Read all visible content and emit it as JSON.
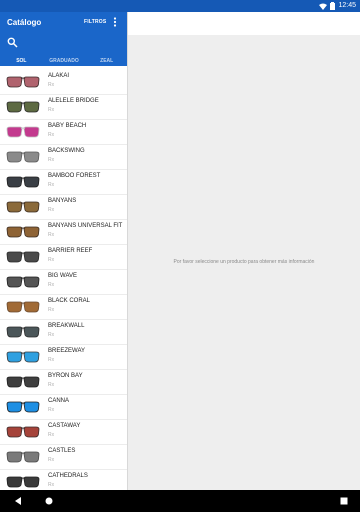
{
  "status_bar": {
    "time": "12:45"
  },
  "header": {
    "title": "Catálogo",
    "filters_label": "FILTROS"
  },
  "tabs": [
    {
      "label": "SOL",
      "active": true
    },
    {
      "label": "GRADUADO",
      "active": false
    },
    {
      "label": "ZEAL",
      "active": false
    }
  ],
  "products": [
    {
      "name": "ALAKAI",
      "sub": "Rx",
      "color": "#b0636e",
      "frame": "#3a2a2a"
    },
    {
      "name": "ALELELE BRIDGE",
      "sub": "Rx",
      "color": "#5d6a42",
      "frame": "#2a2a2a"
    },
    {
      "name": "BABY BEACH",
      "sub": "Rx",
      "color": "#c33a8e",
      "frame": "#c0c0c0"
    },
    {
      "name": "BACKSWING",
      "sub": "Rx",
      "color": "#8a8a8a",
      "frame": "#5a5a5a"
    },
    {
      "name": "BAMBOO FOREST",
      "sub": "Rx",
      "color": "#3a3f45",
      "frame": "#1f1f1f"
    },
    {
      "name": "BANYANS",
      "sub": "Rx",
      "color": "#8b6a3a",
      "frame": "#3a2b20"
    },
    {
      "name": "BANYANS UNIVERSAL FIT",
      "sub": "Rx",
      "color": "#8e6335",
      "frame": "#3a2b20"
    },
    {
      "name": "BARRIER REEF",
      "sub": "Rx",
      "color": "#4a4a4a",
      "frame": "#2a2a2a"
    },
    {
      "name": "BIG WAVE",
      "sub": "Rx",
      "color": "#555555",
      "frame": "#1f1f1f"
    },
    {
      "name": "BLACK CORAL",
      "sub": "Rx",
      "color": "#a16a35",
      "frame": "#6a4a30"
    },
    {
      "name": "BREAKWALL",
      "sub": "Rx",
      "color": "#4b5659",
      "frame": "#2b2b2b"
    },
    {
      "name": "BREEZEWAY",
      "sub": "Rx",
      "color": "#2fa0e0",
      "frame": "#3a3a3a"
    },
    {
      "name": "BYRON BAY",
      "sub": "Rx",
      "color": "#3f3f3f",
      "frame": "#1f1f1f"
    },
    {
      "name": "CANNA",
      "sub": "Rx",
      "color": "#1e8fe3",
      "frame": "#1f1f1f"
    },
    {
      "name": "CASTAWAY",
      "sub": "Rx",
      "color": "#a5433a",
      "frame": "#3a2b2b"
    },
    {
      "name": "CASTLES",
      "sub": "Rx",
      "color": "#7a7a7a",
      "frame": "#4a4a4a"
    },
    {
      "name": "CATHEDRALS",
      "sub": "Rx",
      "color": "#3a3a3a",
      "frame": "#1f1f1f"
    }
  ],
  "detail": {
    "placeholder": "Por favor seleccione un producto para obtener más información"
  },
  "colors": {
    "status_bar": "#1559b5",
    "app_bar": "#1a66c9",
    "detail_bg": "#eeeeee"
  }
}
